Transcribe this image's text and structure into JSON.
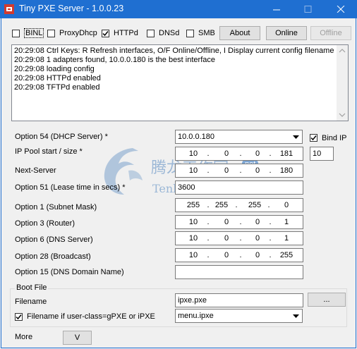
{
  "window": {
    "title": "Tiny PXE Server - 1.0.0.23"
  },
  "toolbar": {
    "checkboxes": [
      {
        "label": "BINL",
        "checked": false
      },
      {
        "label": "ProxyDhcp",
        "checked": false
      },
      {
        "label": "HTTPd",
        "checked": true
      },
      {
        "label": "DNSd",
        "checked": false
      },
      {
        "label": "SMB",
        "checked": false
      }
    ],
    "about_label": "About",
    "online_label": "Online",
    "offline_label": "Offline"
  },
  "log": {
    "lines": [
      "20:29:08 Ctrl Keys: R Refresh interfaces, O/F Online/Offline, I Display current config filename",
      "20:29:08 1 adapters found, 10.0.0.180 is the best interface",
      "20:29:08 loading config",
      "20:29:08 HTTPd enabled",
      "20:29:08 TFTPd enabled"
    ]
  },
  "options": {
    "opt54": {
      "label": "Option 54 (DHCP Server) *",
      "value": "10.0.0.180"
    },
    "bind_ip": {
      "label": "Bind IP",
      "checked": true
    },
    "pool": {
      "label": "IP Pool start / size *",
      "octets": [
        "10",
        "0",
        "0",
        "181"
      ],
      "size": "10"
    },
    "next_server": {
      "label": "Next-Server",
      "octets": [
        "10",
        "0",
        "0",
        "180"
      ]
    },
    "opt51": {
      "label": "Option 51 (Lease time in secs) *",
      "value": "3600"
    },
    "opt1": {
      "label": "Option 1  (Subnet Mask)",
      "octets": [
        "255",
        "255",
        "255",
        "0"
      ]
    },
    "opt3": {
      "label": "Option 3  (Router)",
      "octets": [
        "10",
        "0",
        "0",
        "1"
      ]
    },
    "opt6": {
      "label": "Option 6  (DNS Server)",
      "octets": [
        "10",
        "0",
        "0",
        "1"
      ]
    },
    "opt28": {
      "label": "Option 28 (Broadcast)",
      "octets": [
        "10",
        "0",
        "0",
        "255"
      ]
    },
    "opt15": {
      "label": "Option 15 (DNS Domain Name)",
      "value": ""
    }
  },
  "boot": {
    "group_title": "Boot File",
    "filename_label": "Filename",
    "filename_value": "ipxe.pxe",
    "browse_label": "...",
    "userclass_label": "Filename if user-class=gPXE or iPXE",
    "userclass_checked": true,
    "userclass_value": "menu.ipxe"
  },
  "footer": {
    "more_label": "More",
    "v_label": "V"
  },
  "watermark": {
    "text": "腾龙工作室",
    "badge": "net",
    "url": "Tenlonstudio.com"
  },
  "colors": {
    "titlebar": "#1f6fd1",
    "window_bg": "#f0f0f0",
    "watermark": "#9bb7d6"
  }
}
